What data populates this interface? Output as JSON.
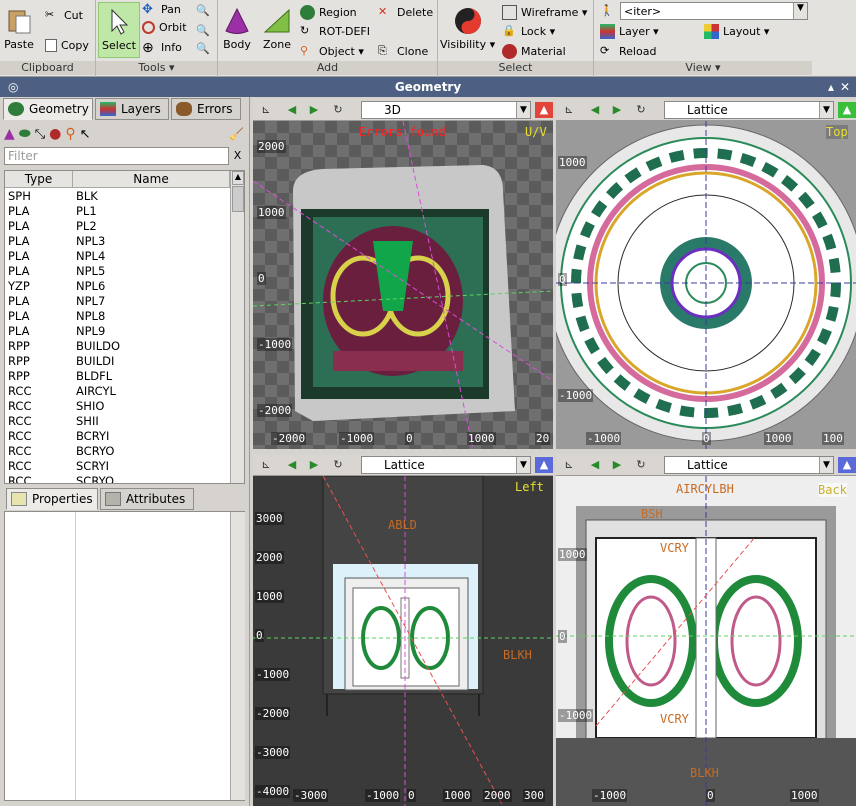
{
  "ribbon": {
    "clipboard": {
      "label": "Clipboard",
      "paste": "Paste",
      "cut": "Cut",
      "copy": "Copy"
    },
    "tools": {
      "label": "Tools",
      "select": "Select",
      "pan": "Pan",
      "orbit": "Orbit",
      "info": "Info"
    },
    "add": {
      "label": "Add",
      "body": "Body",
      "zone": "Zone",
      "region": "Region",
      "rot_defi": "ROT-DEFI",
      "object": "Object",
      "delete": "Delete",
      "clone": "Clone"
    },
    "select": {
      "label": "Select",
      "visibility": "Visibility",
      "wireframe": "Wireframe",
      "lock": "Lock",
      "material": "Material"
    },
    "view": {
      "label": "View",
      "iter": "<iter>",
      "layer": "Layer",
      "layout": "Layout",
      "reload": "Reload"
    }
  },
  "window_title": "Geometry",
  "left": {
    "tabs": [
      "Geometry",
      "Layers",
      "Errors"
    ],
    "filter_placeholder": "Filter",
    "filter_clear": "X",
    "columns": [
      "Type",
      "Name"
    ],
    "rows": [
      [
        "SPH",
        "BLK"
      ],
      [
        "PLA",
        "PL1"
      ],
      [
        "PLA",
        "PL2"
      ],
      [
        "PLA",
        "NPL3"
      ],
      [
        "PLA",
        "NPL4"
      ],
      [
        "PLA",
        "NPL5"
      ],
      [
        "YZP",
        "NPL6"
      ],
      [
        "PLA",
        "NPL7"
      ],
      [
        "PLA",
        "NPL8"
      ],
      [
        "PLA",
        "NPL9"
      ],
      [
        "RPP",
        "BUILDO"
      ],
      [
        "RPP",
        "BUILDI"
      ],
      [
        "RPP",
        "BLDFL"
      ],
      [
        "RCC",
        "AIRCYL"
      ],
      [
        "RCC",
        "SHIO"
      ],
      [
        "RCC",
        "SHII"
      ],
      [
        "RCC",
        "BCRYI"
      ],
      [
        "RCC",
        "BCRYO"
      ],
      [
        "RCC",
        "SCRYI"
      ],
      [
        "RCC",
        "SCRYO"
      ]
    ],
    "bottom_tabs": [
      "Properties",
      "Attributes"
    ]
  },
  "viewports": {
    "tl": {
      "mode": "3D",
      "label": "U/V",
      "error": "Errors found",
      "y_ticks": [
        "2000",
        "1000",
        "0",
        "-1000",
        "-2000"
      ],
      "x_ticks": [
        "-2000",
        "-1000",
        "0",
        "1000",
        "20"
      ]
    },
    "tr": {
      "mode": "Lattice",
      "label": "Top",
      "y_ticks": [
        "1000",
        "0",
        "-1000"
      ],
      "x_ticks": [
        "-1000",
        "0",
        "1000",
        "100"
      ]
    },
    "bl": {
      "mode": "Lattice",
      "label": "Left",
      "y_ticks": [
        "3000",
        "2000",
        "1000",
        "0",
        "-1000",
        "-2000",
        "-3000",
        "-4000"
      ],
      "x_ticks": [
        "-3000",
        "-1000",
        "0",
        "1000",
        "2000",
        "300"
      ],
      "annotations": [
        "ABLD",
        "BLKH"
      ]
    },
    "br": {
      "mode": "Lattice",
      "label": "Back",
      "y_ticks": [
        "1000",
        "0",
        "-1000"
      ],
      "x_ticks": [
        "-1000",
        "0",
        "1000"
      ],
      "annotations": [
        "AIRCYLBH",
        "BSH",
        "VCRY",
        "VCRY",
        "BLKH"
      ]
    }
  },
  "colors": {
    "accent_green": "#1f8a4a",
    "title_bar": "#4d5f82",
    "error_red": "#ff2020",
    "label_yellow": "#e8e030"
  }
}
